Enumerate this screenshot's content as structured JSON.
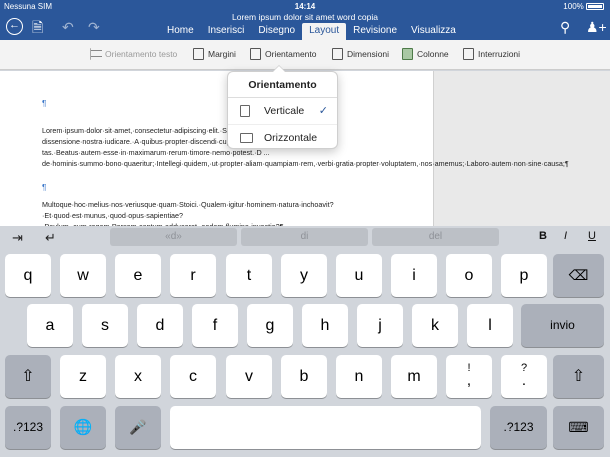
{
  "status": {
    "carrier": "Nessuna SIM",
    "time": "14:14",
    "battery": "100%"
  },
  "title": "Lorem ipsum dolor sit amet word copia",
  "toolbar": {
    "back_icon": "back-arrow-icon",
    "file_icon": "file-icon",
    "undo_icon": "undo-icon",
    "redo_icon": "redo-icon",
    "search_icon": "search-icon",
    "share_icon": "add-person-icon"
  },
  "tabs": [
    "Home",
    "Inserisci",
    "Disegno",
    "Layout",
    "Revisione",
    "Visualizza"
  ],
  "active_tab": "Layout",
  "ribbon": {
    "text_orientation": "Orientamento testo",
    "margins": "Margini",
    "orientation": "Orientamento",
    "size": "Dimensioni",
    "columns": "Colonne",
    "breaks": "Interruzioni"
  },
  "document": {
    "paragraph_mark": "¶",
    "para1": "Lorem·ipsum·dolor·sit·amet,·consectetur·adipiscing·elit.·S ... dissensione·nostra·iudicare.·A·quibus·propter·discendi·cupiditatem·vi ... tas.·Beatus·autem·esse·in·maximarum·rerum·timore·nemo·potest.·D ... de·hominis·summo·bono·quaeritur;·Intellegi·quidem,·ut·propter·aliam·quampiam·rem,·verbi·gratia·propter·voluptatem,·nos·amemus;·Laboro·autem·non·sine·causa;¶",
    "para2": "Multoque·hoc·melius·nos·veriusque·quam·Stoici.·Qualem·igitur·hominem·natura·inchoavit?·Et·quod·est·munus,·quod·opus·sapientiae?·Paulum,·cum·regem·Persem·captum·adduceret,·eodem·flumine·invectio?¶"
  },
  "orientation_menu": {
    "title": "Orientamento",
    "items": [
      {
        "label": "Verticale",
        "selected": true
      },
      {
        "label": "Orizzontale",
        "selected": false
      }
    ]
  },
  "keyboard": {
    "suggestions": [
      "«d»",
      "di",
      "del"
    ],
    "format": [
      "B",
      "I",
      "U"
    ],
    "row1": [
      "q",
      "w",
      "e",
      "r",
      "t",
      "y",
      "u",
      "i",
      "o",
      "p"
    ],
    "row2": [
      "a",
      "s",
      "d",
      "f",
      "g",
      "h",
      "j",
      "k",
      "l"
    ],
    "row3": [
      "z",
      "x",
      "c",
      "v",
      "b",
      "n",
      "m"
    ],
    "enter": "invio",
    "numbers": ".?123",
    "punct1": [
      "!",
      ","
    ],
    "punct2": [
      "?",
      "."
    ]
  }
}
